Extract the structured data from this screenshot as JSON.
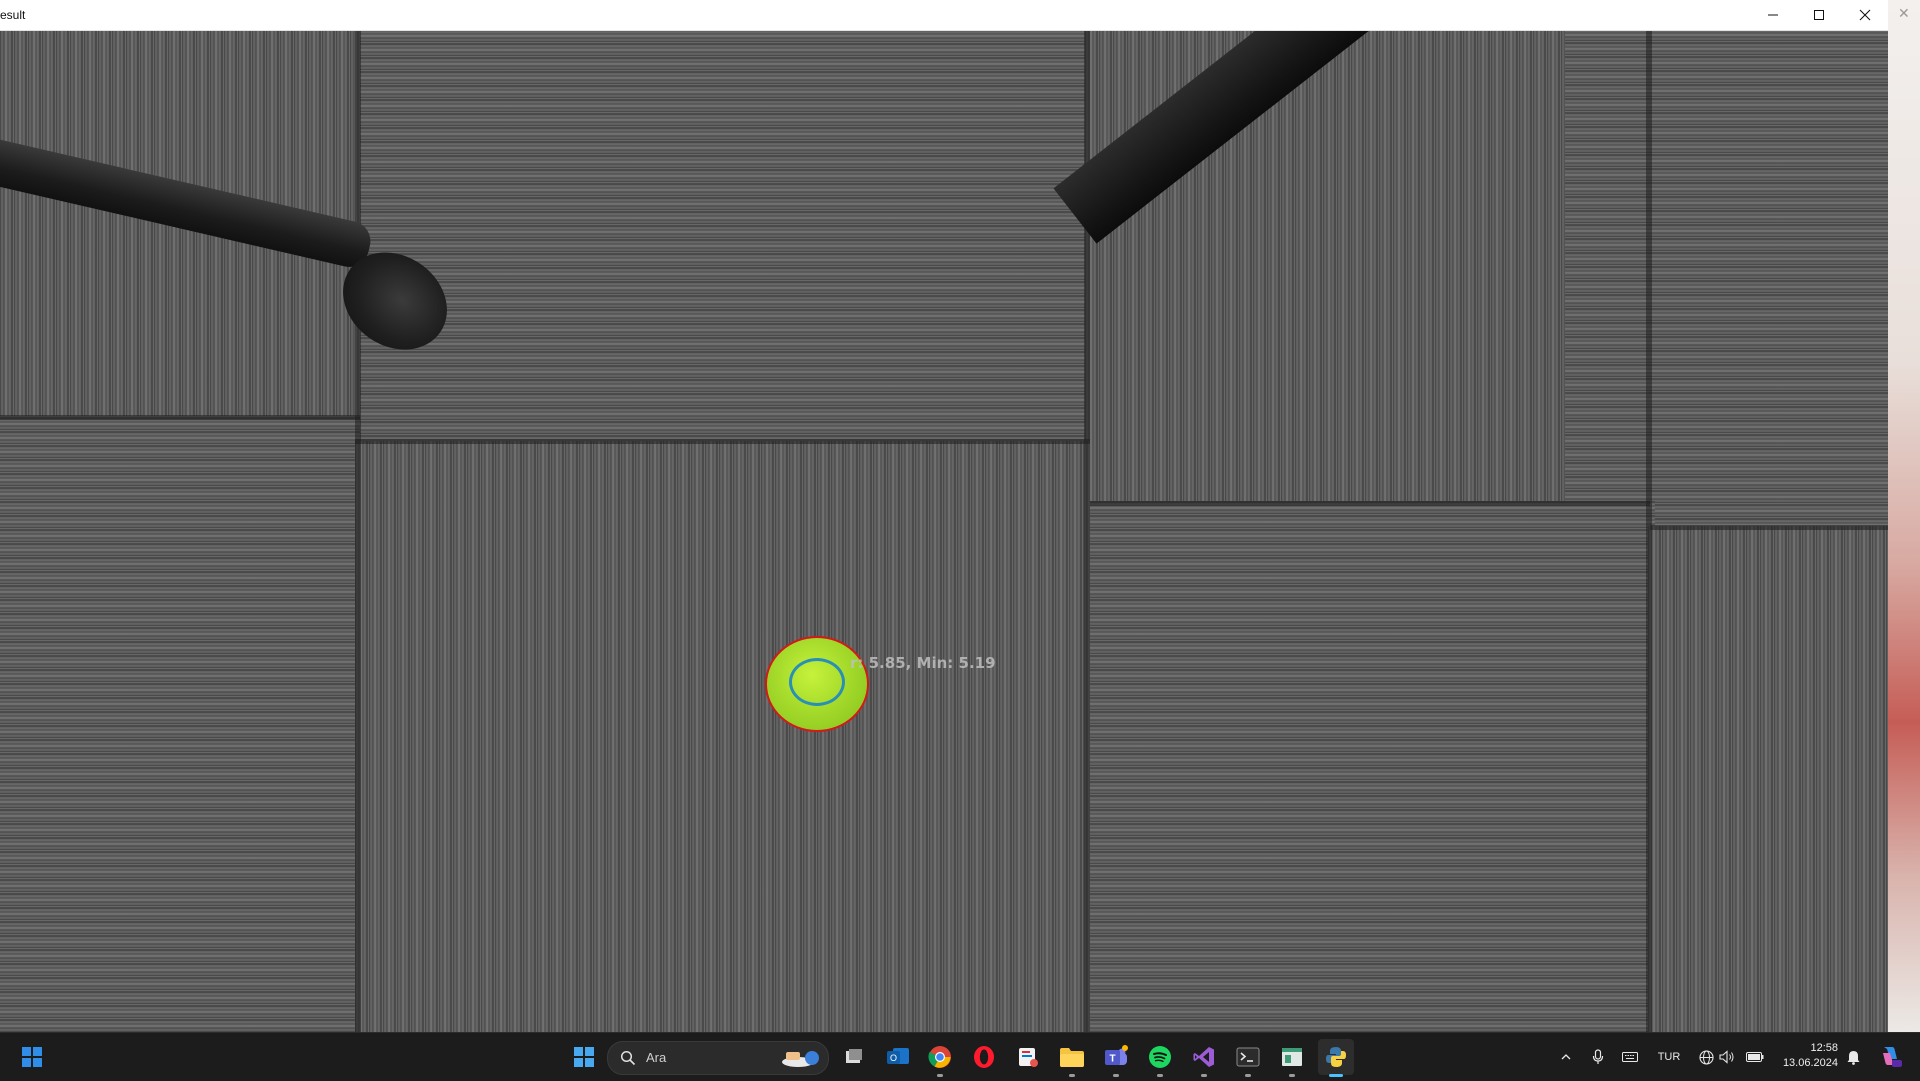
{
  "window": {
    "title": "result"
  },
  "overlay": {
    "text": "r: 5.85, Min: 5.19"
  },
  "taskbar": {
    "search_placeholder": "Ara",
    "language": "TUR",
    "time": "12:58",
    "date": "13.06.2024",
    "pinned": [
      "start",
      "search",
      "task-view",
      "outlook",
      "chrome",
      "opera",
      "snipping-tool",
      "file-explorer",
      "teams",
      "spotify",
      "visual-studio",
      "terminal",
      "notepad",
      "python"
    ]
  },
  "colors": {
    "accent": "#4cc2ff",
    "detection_outline": "#d11a1a",
    "ellipse_fit": "#2a8fb5",
    "ball": "#9fd628"
  }
}
